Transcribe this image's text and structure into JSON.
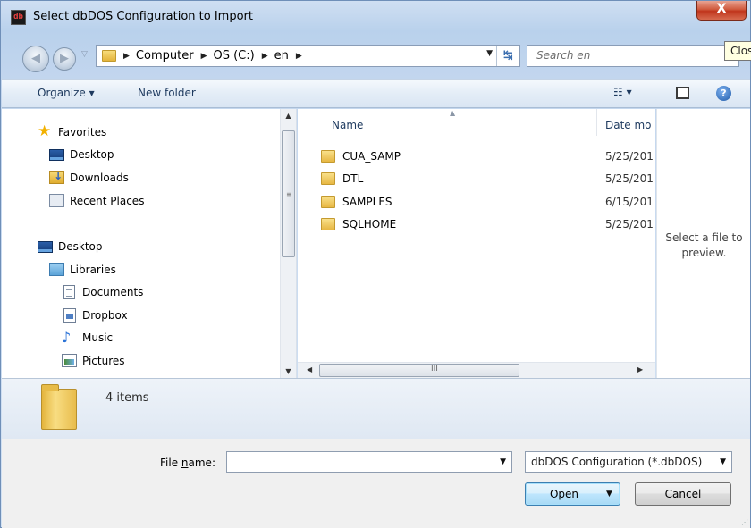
{
  "window": {
    "title": "Select dbDOS Configuration to Import",
    "app_icon_text": "db",
    "close_symbol": "X",
    "close_tooltip": "Clos"
  },
  "nav": {
    "back_icon": "back-arrow-icon",
    "forward_icon": "forward-arrow-icon",
    "breadcrumbs": [
      "Computer",
      "OS (C:)",
      "en"
    ],
    "search_placeholder": "Search en"
  },
  "toolbar": {
    "organize_label": "Organize ▾",
    "new_folder_label": "New folder",
    "views_label": "☷ ▾",
    "help_label": "?"
  },
  "sidebar": {
    "favorites": [
      {
        "label": "Favorites",
        "icon": "star-icon"
      },
      {
        "label": "Desktop",
        "icon": "desktop-icon"
      },
      {
        "label": "Downloads",
        "icon": "downloads-icon"
      },
      {
        "label": "Recent Places",
        "icon": "recent-places-icon"
      }
    ],
    "tree": [
      {
        "label": "Desktop",
        "icon": "desktop-icon"
      },
      {
        "label": "Libraries",
        "icon": "libraries-icon"
      },
      {
        "label": "Documents",
        "icon": "documents-icon"
      },
      {
        "label": "Dropbox",
        "icon": "dropbox-icon"
      },
      {
        "label": "Music",
        "icon": "music-icon"
      },
      {
        "label": "Pictures",
        "icon": "pictures-icon"
      }
    ]
  },
  "filelist": {
    "columns": {
      "name": "Name",
      "date": "Date mo"
    },
    "rows": [
      {
        "name": "CUA_SAMP",
        "date": "5/25/201"
      },
      {
        "name": "DTL",
        "date": "5/25/201"
      },
      {
        "name": "SAMPLES",
        "date": "6/15/201"
      },
      {
        "name": "SQLHOME",
        "date": "5/25/201"
      }
    ],
    "hscroll_grip": "III"
  },
  "preview": {
    "text": "Select a file to preview."
  },
  "details": {
    "item_count": "4 items"
  },
  "footer": {
    "file_name_label_pre": "File ",
    "file_name_label_ul": "n",
    "file_name_label_post": "ame:",
    "file_name_value": "",
    "file_type": "dbDOS Configuration (*.dbDOS)",
    "open_label_ul": "O",
    "open_label_rest": "pen",
    "cancel_label": "Cancel"
  }
}
